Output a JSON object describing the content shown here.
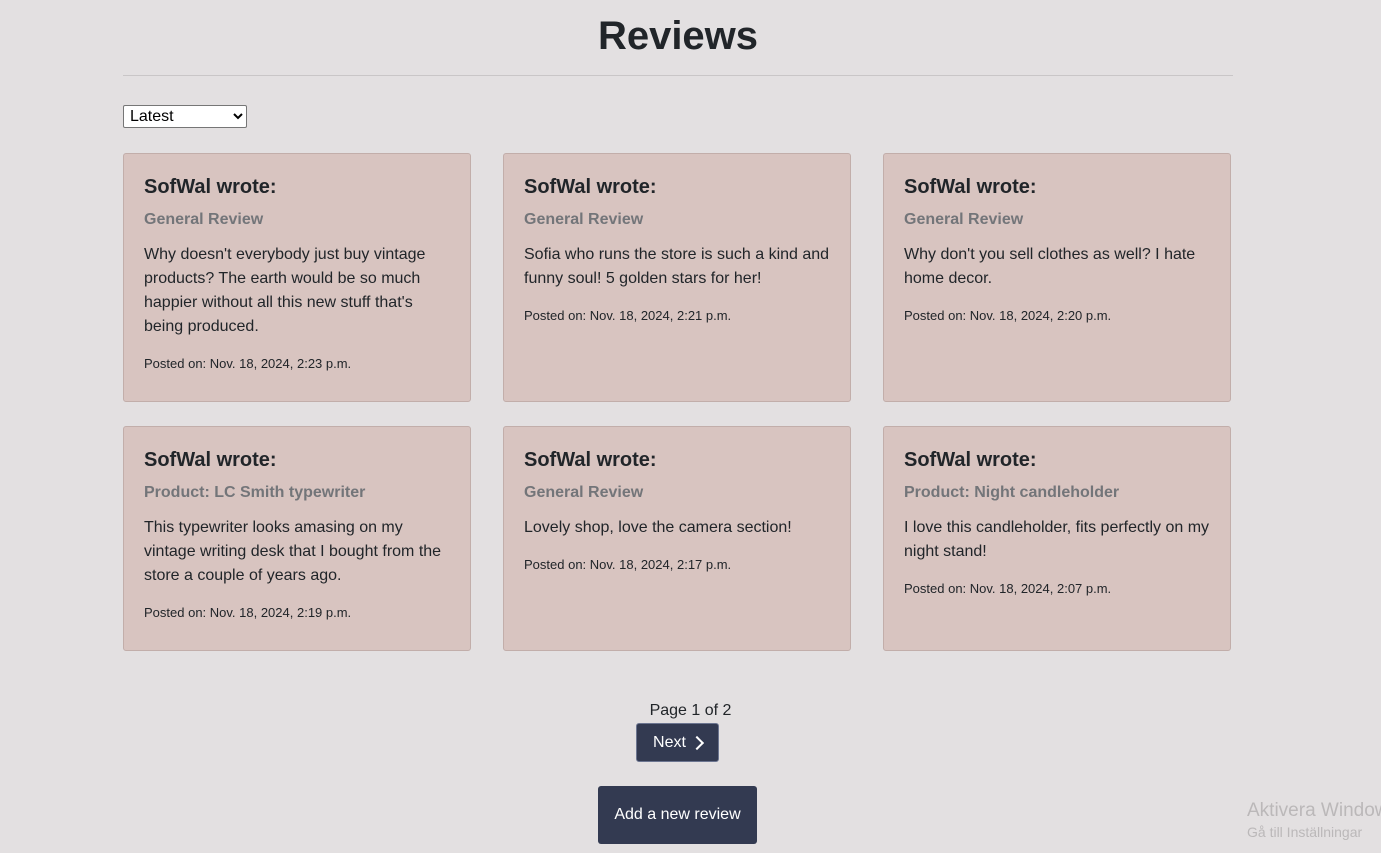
{
  "header": {
    "title": "Reviews"
  },
  "sort": {
    "selected": "Latest"
  },
  "reviews": [
    {
      "author": "SofWal wrote:",
      "subject": "General Review",
      "text": "Why doesn't everybody just buy vintage products? The earth would be so much happier without all this new stuff that's being produced.",
      "posted": "Posted on: Nov. 18, 2024, 2:23 p.m."
    },
    {
      "author": "SofWal wrote:",
      "subject": "General Review",
      "text": "Sofia who runs the store is such a kind and funny soul! 5 golden stars for her!",
      "posted": "Posted on: Nov. 18, 2024, 2:21 p.m."
    },
    {
      "author": "SofWal wrote:",
      "subject": "General Review",
      "text": "Why don't you sell clothes as well? I hate home decor.",
      "posted": "Posted on: Nov. 18, 2024, 2:20 p.m."
    },
    {
      "author": "SofWal wrote:",
      "subject": "Product: LC Smith typewriter",
      "text": "This typewriter looks amasing on my vintage writing desk that I bought from the store a couple of years ago.",
      "posted": "Posted on: Nov. 18, 2024, 2:19 p.m."
    },
    {
      "author": "SofWal wrote:",
      "subject": "General Review",
      "text": "Lovely shop, love the camera section!",
      "posted": "Posted on: Nov. 18, 2024, 2:17 p.m."
    },
    {
      "author": "SofWal wrote:",
      "subject": "Product: Night candleholder",
      "text": "I love this candleholder, fits perfectly on my night stand!",
      "posted": "Posted on: Nov. 18, 2024, 2:07 p.m."
    }
  ],
  "pagination": {
    "info": "Page 1 of 2",
    "next_label": "Next",
    "next_icon": "chevron-right-icon"
  },
  "actions": {
    "add_review_label": "Add a new review"
  },
  "watermark": {
    "title": "Aktivera Windows",
    "subtitle": "Gå till Inställningar"
  },
  "colors": {
    "background": "#e3e0e1",
    "card": "#d8c4c0",
    "button": "#333a51",
    "subtitle": "#737579"
  }
}
